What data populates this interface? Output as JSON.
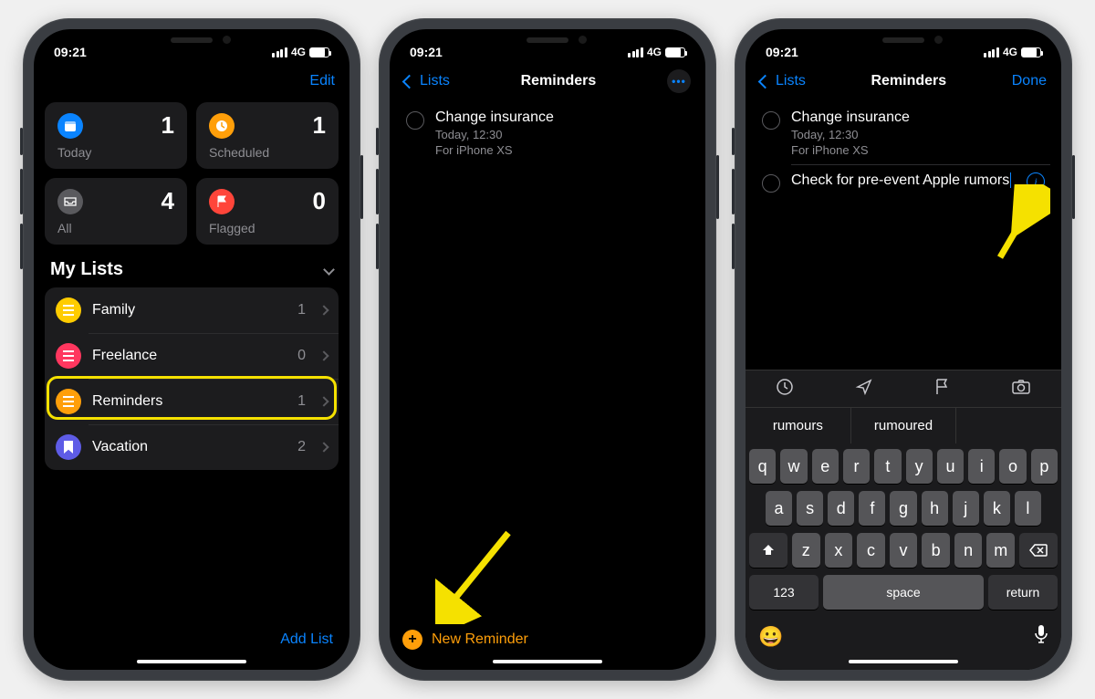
{
  "status": {
    "time": "09:21",
    "network": "4G"
  },
  "screen1": {
    "edit": "Edit",
    "tiles": {
      "today": {
        "label": "Today",
        "count": "1",
        "color": "#0a84ff",
        "glyph": "calendar"
      },
      "scheduled": {
        "label": "Scheduled",
        "count": "1",
        "color": "#ff9f0a",
        "glyph": "clock"
      },
      "all": {
        "label": "All",
        "count": "4",
        "color": "#5a5a5e",
        "glyph": "tray"
      },
      "flagged": {
        "label": "Flagged",
        "count": "0",
        "color": "#ff453a",
        "glyph": "flag"
      }
    },
    "section_title": "My Lists",
    "lists": [
      {
        "name": "Family",
        "count": "1",
        "color": "#ffcc00"
      },
      {
        "name": "Freelance",
        "count": "0",
        "color": "#ff375f"
      },
      {
        "name": "Reminders",
        "count": "1",
        "color": "#ff9f0a"
      },
      {
        "name": "Vacation",
        "count": "2",
        "color": "#5e5ce6"
      }
    ],
    "add_list": "Add List"
  },
  "screen2": {
    "back": "Lists",
    "title": "Reminders",
    "reminder": {
      "title": "Change insurance",
      "time": "Today, 12:30",
      "note": "For iPhone XS"
    },
    "new_reminder": "New Reminder"
  },
  "screen3": {
    "back": "Lists",
    "title": "Reminders",
    "done": "Done",
    "reminder1": {
      "title": "Change insurance",
      "time": "Today, 12:30",
      "note": "For iPhone XS"
    },
    "reminder2": {
      "title": "Check for pre-event Apple rumors"
    },
    "suggestions": {
      "a": "rumours",
      "b": "rumoured"
    },
    "keys": {
      "row1": [
        "q",
        "w",
        "e",
        "r",
        "t",
        "y",
        "u",
        "i",
        "o",
        "p"
      ],
      "row2": [
        "a",
        "s",
        "d",
        "f",
        "g",
        "h",
        "j",
        "k",
        "l"
      ],
      "row3": [
        "z",
        "x",
        "c",
        "v",
        "b",
        "n",
        "m"
      ],
      "num": "123",
      "space": "space",
      "return": "return"
    }
  }
}
